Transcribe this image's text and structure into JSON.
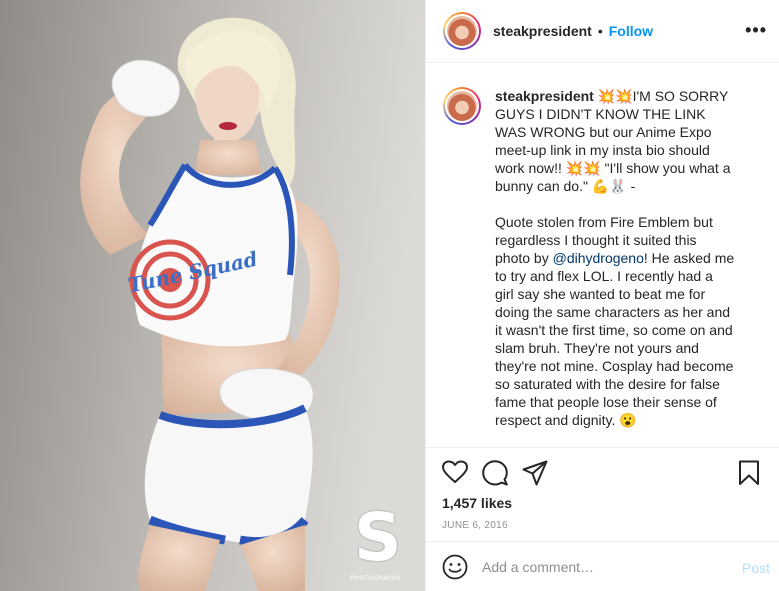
{
  "header": {
    "username": "steakpresident",
    "separator": "•",
    "follow_label": "Follow",
    "more_label": "•••"
  },
  "caption": {
    "username": "steakpresident",
    "paragraph_1": " 💥💥I'M SO SORRY GUYS I DIDN'T KNOW THE LINK WAS WRONG but our Anime Expo meet-up link in my insta bio should work now!! 💥💥 \"I'll show you what a bunny can do.\" 💪🐰 -",
    "paragraph_2_before": "Quote stolen from Fire Emblem but regardless I thought it suited this photo by ",
    "mention": "@dihydrogeno",
    "paragraph_2_after": "! He asked me to try and flex LOL. I recently had a girl say she wanted to beat me for doing the same characters as her and it wasn't the first time, so come on and slam bruh. They're not yours and they're not mine. Cosplay had become so saturated with the desire for false fame that people lose their sense of respect and dignity. 😮"
  },
  "photo": {
    "shirt_text": "Tune Squad",
    "watermark_mark": "S",
    "watermark_label": "PHOTOGRAPHY"
  },
  "actions": {
    "icons": [
      "heart-icon",
      "comment-icon",
      "share-icon",
      "bookmark-icon"
    ],
    "likes": "1,457 likes",
    "date": "JUNE 6, 2016"
  },
  "comment": {
    "placeholder": "Add a comment…",
    "post_label": "Post"
  },
  "colors": {
    "follow": "#0095f6",
    "post_disabled": "#b2dffc",
    "mention": "#00376b",
    "muted": "#8e8e8e",
    "jersey_trim": "#2b56b8",
    "logo_red": "#d9534f"
  }
}
